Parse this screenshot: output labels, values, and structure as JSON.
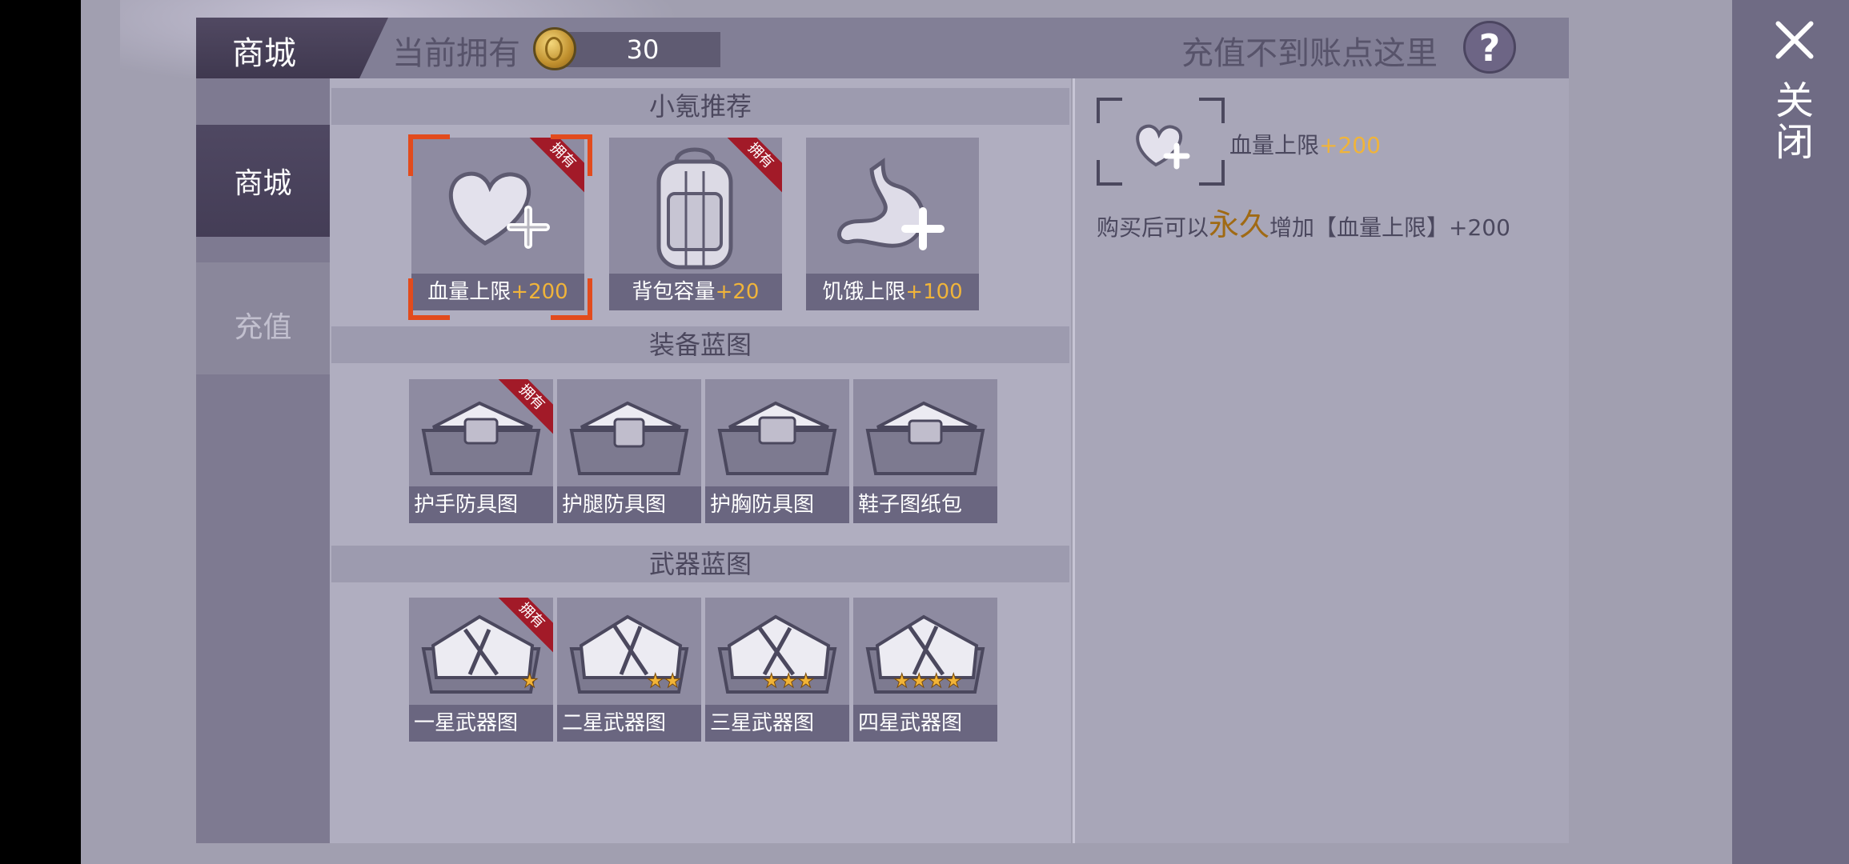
{
  "header": {
    "tab_label": "商城",
    "owned_label": "当前拥有",
    "coin_value": "30",
    "recharge_help_label": "充值不到账点这里",
    "help_icon_glyph": "?"
  },
  "sidebar": {
    "items": [
      {
        "label": "商城",
        "active": true
      },
      {
        "label": "充值",
        "active": false
      }
    ]
  },
  "close": {
    "label": "关闭"
  },
  "sections": {
    "recommend": {
      "title": "小氪推荐",
      "items": [
        {
          "name": "血量上限",
          "bonus": "+200",
          "owned": true,
          "icon": "heart-plus-icon",
          "selected": true
        },
        {
          "name": "背包容量",
          "bonus": "+20",
          "owned": true,
          "icon": "backpack-icon",
          "selected": false
        },
        {
          "name": "饥饿上限",
          "bonus": "+100",
          "owned": false,
          "icon": "stomach-plus-icon",
          "selected": false
        }
      ]
    },
    "equipment": {
      "title": "装备蓝图",
      "items": [
        {
          "name": "护手防具图",
          "owned": true
        },
        {
          "name": "护腿防具图",
          "owned": false
        },
        {
          "name": "护胸防具图",
          "owned": false
        },
        {
          "name": "鞋子图纸包",
          "owned": false
        }
      ]
    },
    "weapons": {
      "title": "武器蓝图",
      "items": [
        {
          "name": "一星武器图",
          "stars": 1,
          "owned": true
        },
        {
          "name": "二星武器图",
          "stars": 2,
          "owned": false
        },
        {
          "name": "三星武器图",
          "stars": 3,
          "owned": false
        },
        {
          "name": "四星武器图",
          "stars": 4,
          "owned": false
        }
      ]
    },
    "owned_badge": "拥有"
  },
  "detail": {
    "name": "血量上限",
    "bonus": "+200",
    "desc_prefix": "购买后可以",
    "desc_emph": "永久",
    "desc_suffix": "增加【血量上限】+200"
  },
  "colors": {
    "accent_bonus": "#f0b43a",
    "owned_ribbon": "#a21a28",
    "selection": "#e24b1d"
  }
}
